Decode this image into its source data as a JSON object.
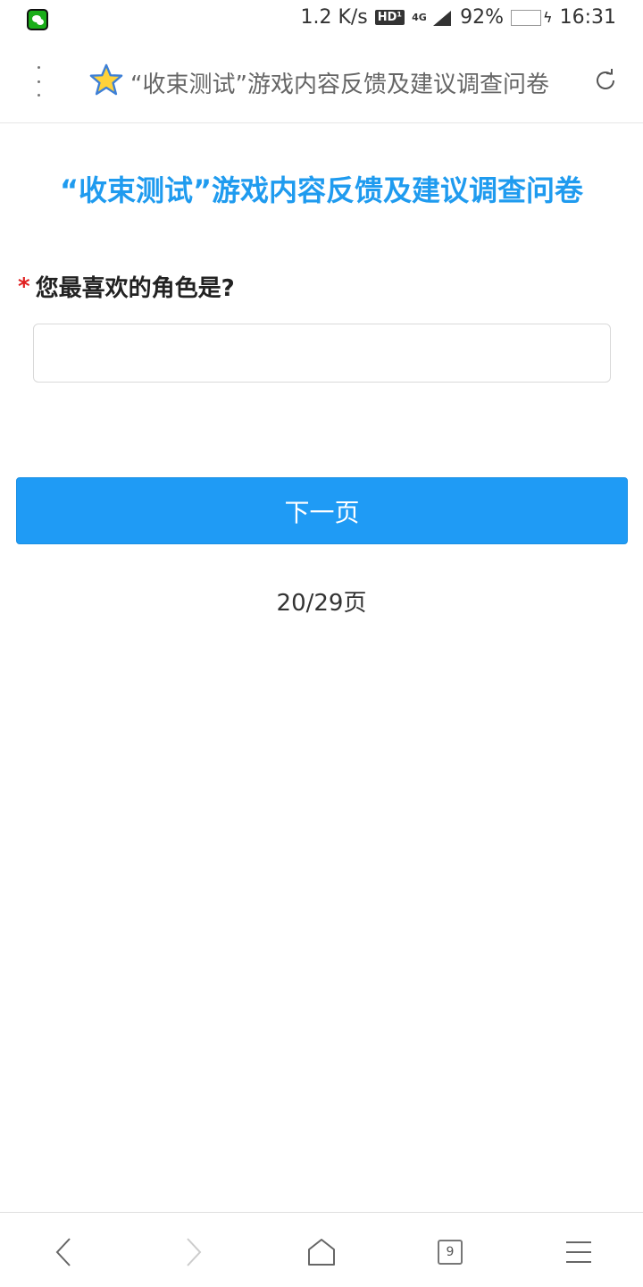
{
  "status_bar": {
    "network_speed": "1.2 K/s",
    "hd_label": "HD¹",
    "network_type": "4G",
    "battery_percent": "92%",
    "battery_level": 0.92,
    "time": "16:31",
    "colors": {
      "battery": "#44e48a"
    }
  },
  "browser": {
    "tab_title": "“收束测试”游戏内容反馈及建议调查问卷",
    "tab_count": "9"
  },
  "survey": {
    "title": "“收束测试”游戏内容反馈及建议调查问卷",
    "required_mark": "*",
    "question": "您最喜欢的角色是?",
    "answer_value": "",
    "next_button": "下一页",
    "page_indicator": "20/29页"
  },
  "colors": {
    "accent": "#1f9bef",
    "button": "#1f9bf5",
    "required": "#e02020"
  }
}
